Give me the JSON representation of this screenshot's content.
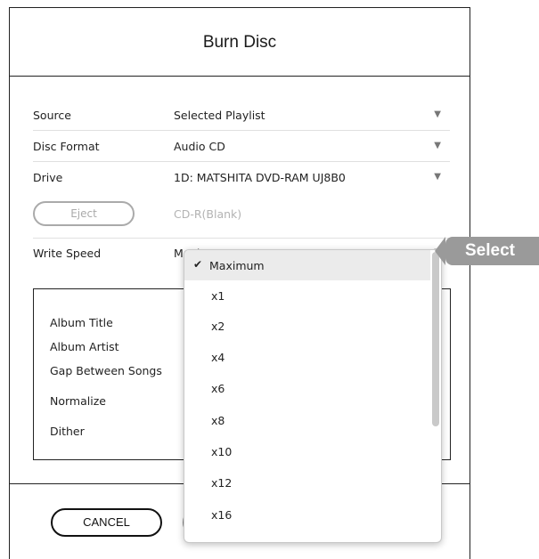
{
  "dialog": {
    "title": "Burn Disc"
  },
  "settings": {
    "source": {
      "label": "Source",
      "value": "Selected Playlist"
    },
    "disc_format": {
      "label": "Disc Format",
      "value": "Audio CD"
    },
    "drive": {
      "label": "Drive",
      "value": "1D: MATSHITA DVD-RAM UJ8B0"
    },
    "eject_label": "Eject",
    "media_status": "CD-R(Blank)",
    "write_speed": {
      "label": "Write Speed",
      "value": "Maximum"
    }
  },
  "options": {
    "album_title": "Album Title",
    "album_artist": "Album Artist",
    "gap_between_songs": "Gap Between Songs",
    "normalize": "Normalize",
    "dither": "Dither"
  },
  "footer": {
    "cancel_label": "CANCEL"
  },
  "dropdown": {
    "items": [
      "Maximum",
      "x1",
      "x2",
      "x4",
      "x6",
      "x8",
      "x10",
      "x12",
      "x16"
    ],
    "selected": "Maximum"
  },
  "annotation": {
    "tag_label": "Select"
  },
  "colors": {
    "border": "#222222",
    "disabled": "#aaaaaa",
    "selected_bg": "#ebebeb",
    "tag_bg": "#9a9a9a"
  }
}
